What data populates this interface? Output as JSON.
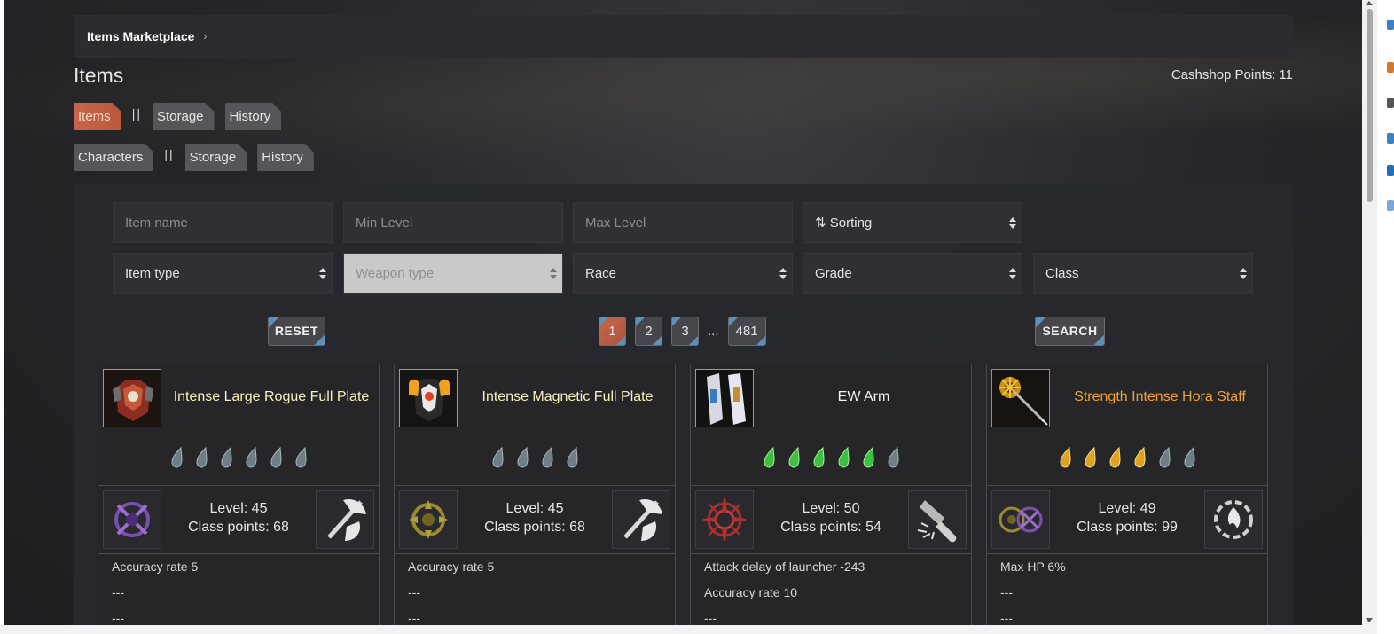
{
  "breadcrumb": {
    "label": "Items Marketplace",
    "chevron": "›"
  },
  "header": {
    "title": "Items",
    "cash_label": "Cashshop Points:",
    "cash_value": "11"
  },
  "tabs_items": {
    "items": "Items",
    "sep": "||",
    "storage": "Storage",
    "history": "History"
  },
  "tabs_characters": {
    "characters": "Characters",
    "sep": "||",
    "storage": "Storage",
    "history": "History"
  },
  "filters": {
    "item_name_placeholder": "Item name",
    "min_level_placeholder": "Min Level",
    "max_level_placeholder": "Max Level",
    "sorting": "⇅ Sorting",
    "item_type": "Item type",
    "weapon_type": "Weapon type",
    "race": "Race",
    "grade": "Grade",
    "class": "Class"
  },
  "buttons": {
    "reset": "RESET",
    "search": "SEARCH"
  },
  "pagination": {
    "pages": [
      "1",
      "2",
      "3"
    ],
    "ellipsis": "...",
    "last": "481",
    "active": "1"
  },
  "colors": {
    "accent": "#c8654a",
    "corner": "#5e90b8",
    "name_yellow": "#f3f1c0",
    "name_orange": "#f0a23a"
  },
  "cards": [
    {
      "name": "Intense Large Rogue Full Plate",
      "name_color": "yellow",
      "icon": "rogue-armor-icon",
      "gems": [
        "gray",
        "gray",
        "gray",
        "gray",
        "gray",
        "gray"
      ],
      "race_icon": "purple-race-icon",
      "weapon_icon": "axe-icon",
      "level": "Level: 45",
      "class_points": "Class points: 68",
      "stats": [
        "Accuracy rate 5",
        "---",
        "---"
      ]
    },
    {
      "name": "Intense Magnetic Full Plate",
      "name_color": "yellow",
      "icon": "magnetic-armor-icon",
      "gems": [
        "gray",
        "gray",
        "gray",
        "gray"
      ],
      "race_icon": "gold-race-icon",
      "weapon_icon": "axe-icon",
      "level": "Level: 45",
      "class_points": "Class points: 68",
      "stats": [
        "Accuracy rate 5",
        "---",
        "---"
      ]
    },
    {
      "name": "EW Arm",
      "name_color": "white",
      "icon": "ew-arm-icon",
      "gems": [
        "green",
        "green",
        "green",
        "green",
        "green",
        "gray"
      ],
      "race_icon": "red-race-icon",
      "weapon_icon": "launcher-icon",
      "level": "Level: 50",
      "class_points": "Class points: 54",
      "stats": [
        "Attack delay of launcher -243",
        "Accuracy rate 10",
        "---"
      ]
    },
    {
      "name": "Strength Intense Hora Staff",
      "name_color": "orange",
      "icon": "hora-staff-icon",
      "gems": [
        "gold",
        "gold",
        "gold",
        "gold",
        "gray",
        "gray"
      ],
      "race_icon": "dual-race-icon",
      "weapon_icon": "fire-spiral-icon",
      "level": "Level: 49",
      "class_points": "Class points: 99",
      "stats": [
        "Max HP 6%",
        "---",
        "---"
      ]
    }
  ]
}
